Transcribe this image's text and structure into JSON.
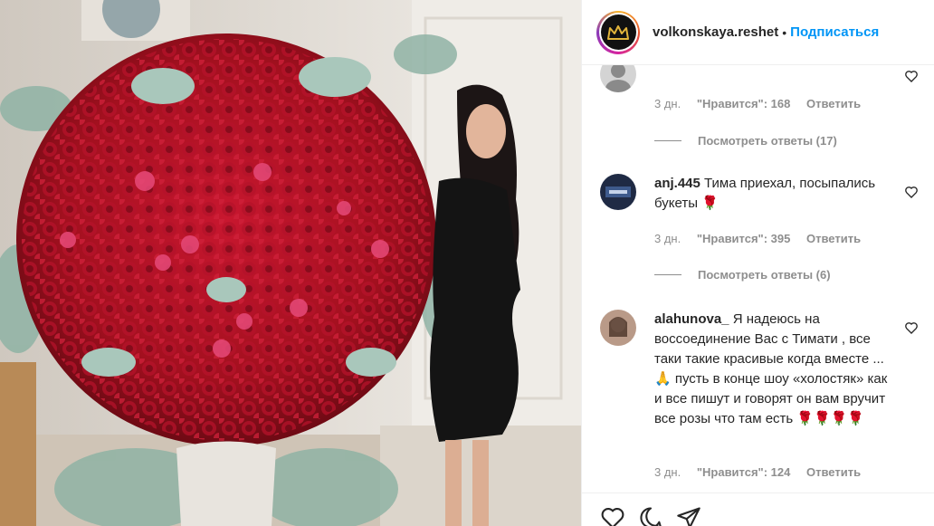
{
  "header": {
    "username": "volkonskaya.reshet",
    "separator": "•",
    "follow_label": "Подписаться"
  },
  "comments": [
    {
      "username": "",
      "text": "",
      "time": "3 дн.",
      "likes": "\"Нравится\": 168",
      "reply_label": "Ответить",
      "view_replies": "Посмотреть ответы (17)",
      "avatar_color": "#c9c9c9"
    },
    {
      "username": "anj.445",
      "text": "Тима приехал, посыпались букеты 🌹",
      "time": "3 дн.",
      "likes": "\"Нравится\": 395",
      "reply_label": "Ответить",
      "view_replies": "Посмотреть ответы (6)",
      "avatar_color": "#1f2a44"
    },
    {
      "username": "alahunova_",
      "text": "Я надеюсь на воссоединение Вас с Тимати , все таки такие красивые когда вместе ... 🙏 пусть в конце шоу «холостяк» как и все пишут и говорят он вам вручит все розы что там есть 🌹🌹🌹🌹",
      "time": "3 дн.",
      "likes": "\"Нравится\": 124",
      "reply_label": "Ответить",
      "avatar_color": "#a98a7a"
    }
  ],
  "actions": [
    "heart-icon",
    "comment-icon",
    "share-icon"
  ],
  "colors": {
    "accent": "#0095f6",
    "text": "#262626",
    "muted": "#8e8e8e",
    "rose": "#b3142a"
  }
}
